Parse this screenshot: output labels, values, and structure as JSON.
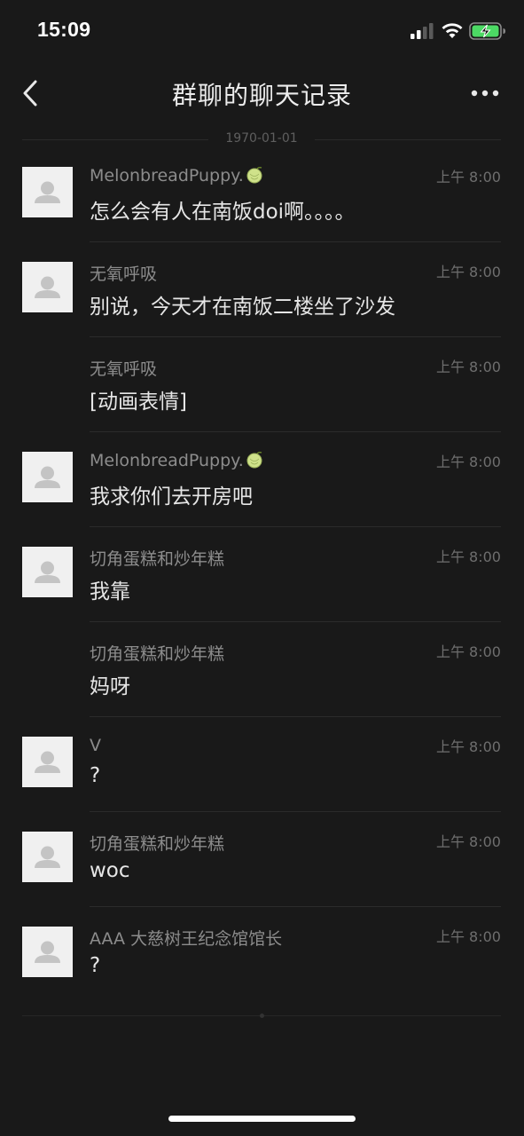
{
  "status_bar": {
    "time": "15:09"
  },
  "nav": {
    "title": "群聊的聊天记录"
  },
  "date_separator": "1970-01-01",
  "messages": [
    {
      "sender": "MelonbreadPuppy.",
      "has_badge": true,
      "show_avatar": true,
      "time": "上午 8:00",
      "text": "怎么会有人在南饭doi啊。。。。"
    },
    {
      "sender": "无氧呼吸",
      "has_badge": false,
      "show_avatar": true,
      "time": "上午 8:00",
      "text": "别说，今天才在南饭二楼坐了沙发"
    },
    {
      "sender": "无氧呼吸",
      "has_badge": false,
      "show_avatar": false,
      "time": "上午 8:00",
      "text": "[动画表情]"
    },
    {
      "sender": "MelonbreadPuppy.",
      "has_badge": true,
      "show_avatar": true,
      "time": "上午 8:00",
      "text": "我求你们去开房吧"
    },
    {
      "sender": "切角蛋糕和炒年糕",
      "has_badge": false,
      "show_avatar": true,
      "time": "上午 8:00",
      "text": "我靠"
    },
    {
      "sender": "切角蛋糕和炒年糕",
      "has_badge": false,
      "show_avatar": false,
      "time": "上午 8:00",
      "text": "妈呀"
    },
    {
      "sender": "V",
      "has_badge": false,
      "show_avatar": true,
      "time": "上午 8:00",
      "text": "?"
    },
    {
      "sender": "切角蛋糕和炒年糕",
      "has_badge": false,
      "show_avatar": true,
      "time": "上午 8:00",
      "text": "woc"
    },
    {
      "sender": "AAA 大慈树王纪念馆馆长",
      "has_badge": false,
      "show_avatar": true,
      "time": "上午 8:00",
      "text": "?"
    }
  ],
  "icons": {
    "signal": "cellular-signal-icon",
    "wifi": "wifi-icon",
    "battery": "battery-charging-icon",
    "back": "chevron-left-icon",
    "more": "more-icon",
    "avatar": "default-avatar-icon",
    "badge": "melon-emoji-icon"
  },
  "colors": {
    "background": "#191919",
    "battery_fill": "#4cd964"
  }
}
